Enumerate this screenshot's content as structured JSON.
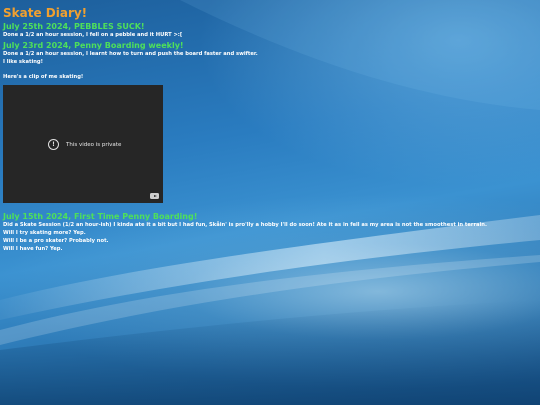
{
  "page": {
    "title": "Skate Diary!"
  },
  "entries": [
    {
      "heading": "July 25th 2024, PEBBLES SUCK!",
      "body": "Done a 1/2 an hour session, I fell on a pebble and it HURT >:["
    },
    {
      "heading": "July 23rd 2024, Penny Boarding weekly!",
      "body": "Done a 1/2 an hour session, I learnt how to turn and push the board faster and swifter.\nI like skating!",
      "clip_intro": "Here's a clip of me skating!",
      "video": {
        "message": "This video is private",
        "info_icon": "info-circle-icon",
        "brand_icon": "youtube-icon"
      }
    },
    {
      "heading": "July 15th 2024, First Time Penny Boarding!",
      "body": "Did a Skate Session (1/2 an hour-ish) I kinda ate it a bit but I had fun, Skåin' is pro'lly a hobby I'll do soon! Ate it as in fell as my area is not the smoothest in terrain.\nWill I try skating more? Yep.\nWill I be a pro skater? Probably not.\nWill I have fun? Yep."
    }
  ],
  "colors": {
    "title": "#f0a030",
    "heading": "#4ee05a",
    "text": "#ffffff",
    "video_bg": "#262626"
  }
}
